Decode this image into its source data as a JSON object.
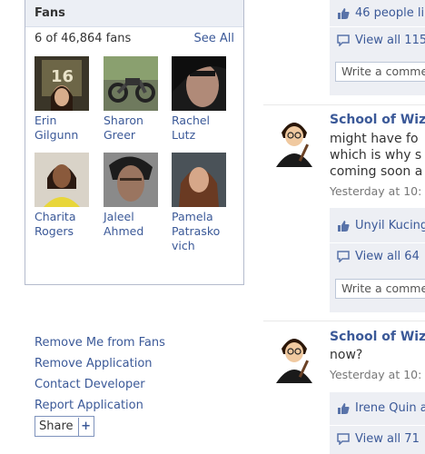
{
  "fans": {
    "title": "Fans",
    "count_text": "6 of 46,864 fans",
    "see_all": "See All",
    "people": [
      {
        "name": "Erin Gilgunn"
      },
      {
        "name": "Sharon Greer"
      },
      {
        "name": "Rachel Lutz"
      },
      {
        "name": "Charita Rogers"
      },
      {
        "name": "Jaleel Ahmed"
      },
      {
        "name": "Pamela Patrasko vich"
      }
    ]
  },
  "links": {
    "remove_fans": "Remove Me from Fans",
    "remove_app": "Remove Application",
    "contact_dev": "Contact Developer",
    "report_app": "Report Application",
    "share": "Share",
    "share_plus": "+"
  },
  "feed": {
    "top": {
      "likes": "46 people li",
      "view_all": "View all 115",
      "comment_placeholder": "Write a comme"
    },
    "post1": {
      "title": "School of Wiz",
      "line1": "might have fo",
      "line2": "which is why s",
      "line3": "coming soon a",
      "time": "Yesterday at 10:",
      "likes": "Unyil Kucing",
      "view_all": "View all 64",
      "comment_placeholder": "Write a comme"
    },
    "post2": {
      "title": "School of Wiz",
      "line1": "now?",
      "time": "Yesterday at 10:",
      "likes": "Irene Quin a",
      "view_all": "View all 71"
    }
  },
  "colors": {
    "link": "#3b5998",
    "header_bg": "#eceff5",
    "feed_bg": "#edeff4"
  }
}
